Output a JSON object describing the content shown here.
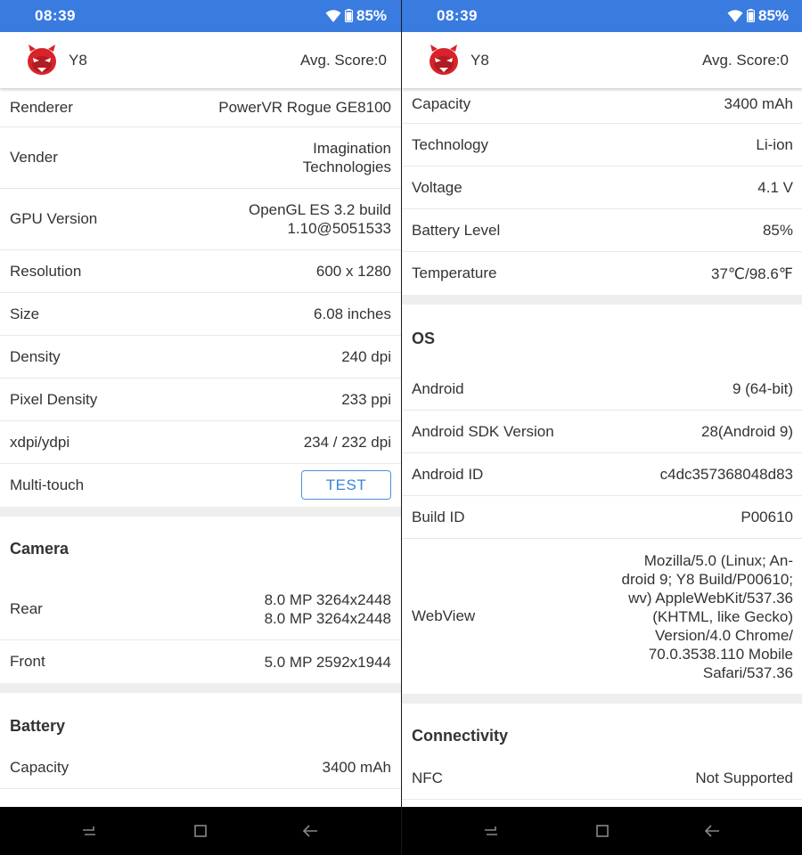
{
  "status": {
    "time": "08:39",
    "battery": "85%"
  },
  "header": {
    "model": "Y8",
    "score": "Avg. Score:0"
  },
  "left": {
    "gpu_rows": [
      {
        "label": "Renderer",
        "value": "PowerVR Rogue GE8100"
      },
      {
        "label": "Vender",
        "value": "Imagination\nTechnologies"
      },
      {
        "label": "GPU Version",
        "value": "OpenGL ES 3.2 build\n1.10@5051533"
      },
      {
        "label": "Resolution",
        "value": "600 x 1280"
      },
      {
        "label": "Size",
        "value": "6.08 inches"
      },
      {
        "label": "Density",
        "value": "240 dpi"
      },
      {
        "label": "Pixel Density",
        "value": "233 ppi"
      },
      {
        "label": "xdpi/ydpi",
        "value": "234 / 232 dpi"
      }
    ],
    "multitouch": {
      "label": "Multi-touch",
      "button": "TEST"
    },
    "camera": {
      "title": "Camera",
      "rows": [
        {
          "label": "Rear",
          "value": "8.0 MP 3264x2448\n8.0 MP 3264x2448"
        },
        {
          "label": "Front",
          "value": "5.0 MP 2592x1944"
        }
      ]
    },
    "battery": {
      "title": "Battery",
      "rows": [
        {
          "label": "Capacity",
          "value": "3400 mAh"
        }
      ]
    }
  },
  "right": {
    "battery_rows": [
      {
        "label": "Capacity",
        "value": "3400 mAh"
      },
      {
        "label": "Technology",
        "value": "Li-ion"
      },
      {
        "label": "Voltage",
        "value": "4.1 V"
      },
      {
        "label": "Battery Level",
        "value": "85%"
      },
      {
        "label": "Temperature",
        "value": "37℃/98.6℉"
      }
    ],
    "os": {
      "title": "OS",
      "rows": [
        {
          "label": "Android",
          "value": "9 (64-bit)"
        },
        {
          "label": "Android SDK Version",
          "value": "28(Android 9)"
        },
        {
          "label": "Android ID",
          "value": "c4dc357368048d83"
        },
        {
          "label": "Build ID",
          "value": "P00610"
        },
        {
          "label": "WebView",
          "value": "Mozilla/5.0 (Linux; An-\ndroid 9; Y8 Build/P00610;\nwv) AppleWebKit/537.36\n(KHTML, like Gecko)\nVersion/4.0 Chrome/\n70.0.3538.110 Mobile\nSafari/537.36"
        }
      ]
    },
    "connectivity": {
      "title": "Connectivity",
      "rows": [
        {
          "label": "NFC",
          "value": "Not Supported"
        }
      ]
    }
  },
  "colors": {
    "statusbar": "#3a7be0",
    "accent": "#3a84d6",
    "navbar": "#000000",
    "section_gap": "#eeeeee"
  },
  "icons": [
    "wifi-icon",
    "battery-icon",
    "antutu-logo-icon",
    "recent-apps-icon",
    "home-icon",
    "back-icon"
  ]
}
